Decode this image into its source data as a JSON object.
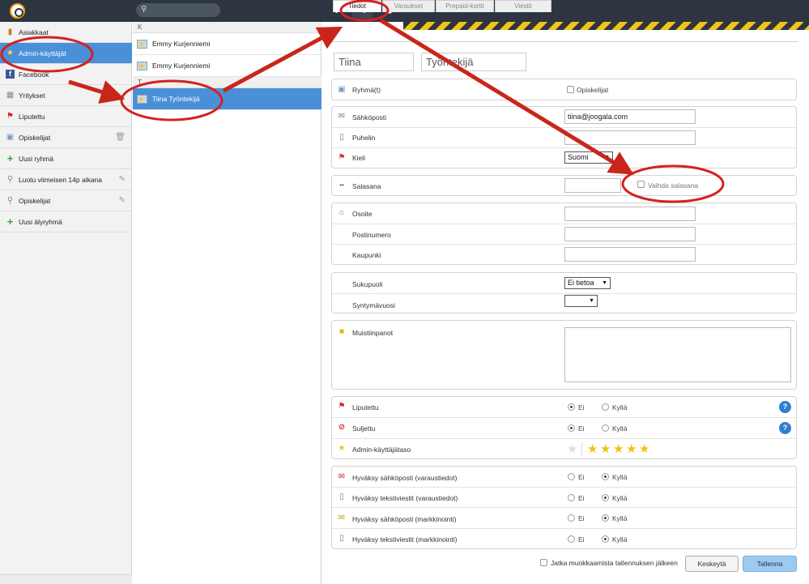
{
  "toolbar": {
    "add": "+",
    "edit": "✎",
    "delete": "🗑"
  },
  "sidebar": {
    "items": [
      {
        "label": "Asiakkaat",
        "icon": "book-icon"
      },
      {
        "label": "Admin-käyttäjät",
        "icon": "star-icon"
      },
      {
        "label": "Facebook",
        "icon": "facebook-icon"
      },
      {
        "label": "Yritykset",
        "icon": "building-icon"
      },
      {
        "label": "Liputettu",
        "icon": "flag-icon"
      },
      {
        "label": "Opiskelijat",
        "icon": "contact-icon"
      },
      {
        "label": "Uusi ryhmä",
        "icon": "plus-icon"
      },
      {
        "label": "Luotu viimeisen 14p aikana",
        "icon": "search-icon"
      },
      {
        "label": "Opiskelijat",
        "icon": "search-icon"
      },
      {
        "label": "Uusi älyryhmä",
        "icon": "plus-icon"
      }
    ]
  },
  "list": {
    "group_k": "K",
    "group_t": "T",
    "people": [
      "Emmy Kurjenniemi",
      "Emmy Kurjenniemi",
      "Tiina Työntekijä"
    ]
  },
  "tabs": [
    "Tiedot",
    "Varaukset",
    "Prepaid-kortit",
    "Viestit"
  ],
  "form": {
    "first_name": "Tiina",
    "last_name": "Työntekijä",
    "group_label": "Ryhmä(t)",
    "group_option": "Opiskelijat",
    "email_label": "Sähköposti",
    "email_value": "tiina@joogala.com",
    "phone_label": "Puhelin",
    "language_label": "Kieli",
    "language_value": "Suomi",
    "password_label": "Salasana",
    "change_password": "Vaihda salasana",
    "address_label": "Osoite",
    "postal_label": "Postinumero",
    "city_label": "Kaupunki",
    "gender_label": "Sukupuoli",
    "gender_value": "Ei tietoa",
    "birthyear_label": "Syntymävuosi",
    "notes_label": "Muistiinpanot",
    "flagged_label": "Liputettu",
    "blocked_label": "Suljettu",
    "admin_level_label": "Admin-käyttäjätaso",
    "consent_email_res": "Hyväksy sähköposti (varaustiedot)",
    "consent_sms_res": "Hyväksy tekstiviestit (varaustiedot)",
    "consent_email_mkt": "Hyväksy sähköposti (markkinointi)",
    "consent_sms_mkt": "Hyväksy tekstiviestit (markkinointi)",
    "no": "Ei",
    "yes": "Kyllä",
    "help": "?"
  },
  "footer": {
    "continue_editing": "Jatka muokkaamista tallennuksen jälkeen",
    "cancel": "Keskeytä",
    "save": "Tallenna"
  },
  "admin_level": {
    "stars": 5,
    "max": 5
  },
  "colors": {
    "accent": "#4a90d9",
    "annotation": "#d42121",
    "topbar": "#2d3540"
  }
}
